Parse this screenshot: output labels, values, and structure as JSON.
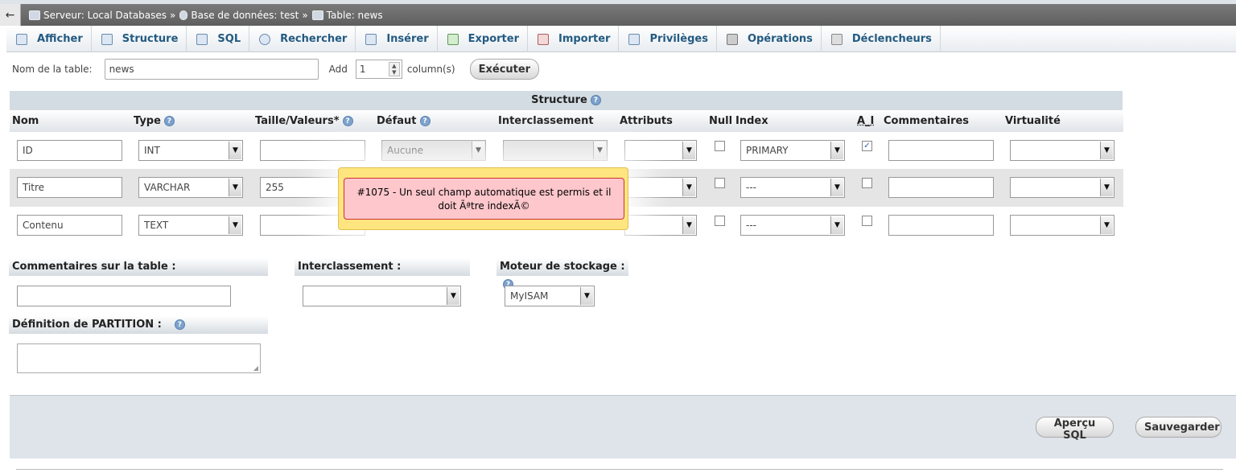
{
  "breadcrumb": {
    "back": "←",
    "server": "Serveur: Local Databases",
    "database": "Base de données: test",
    "table": "Table: news",
    "separator": "»"
  },
  "tabs": [
    {
      "label": "Afficher",
      "icon": "browse-icon"
    },
    {
      "label": "Structure",
      "icon": "structure-icon"
    },
    {
      "label": "SQL",
      "icon": "sql-icon"
    },
    {
      "label": "Rechercher",
      "icon": "search-icon"
    },
    {
      "label": "Insérer",
      "icon": "insert-icon"
    },
    {
      "label": "Exporter",
      "icon": "export-icon"
    },
    {
      "label": "Importer",
      "icon": "import-icon"
    },
    {
      "label": "Privilèges",
      "icon": "privileges-icon"
    },
    {
      "label": "Opérations",
      "icon": "wrench-icon"
    },
    {
      "label": "Déclencheurs",
      "icon": "triggers-icon"
    }
  ],
  "name_bar": {
    "table_name_label": "Nom de la table:",
    "table_name_value": "news",
    "add_label": "Add",
    "add_count": "1",
    "columns_label": "column(s)",
    "execute_label": "Exécuter"
  },
  "structure": {
    "title": "Structure",
    "headers": {
      "nom": "Nom",
      "type": "Type",
      "taille": "Taille/Valeurs*",
      "defaut": "Défaut",
      "interclassement": "Interclassement",
      "attributs": "Attributs",
      "null": "Null",
      "index": "Index",
      "ai": "A_I",
      "commentaires": "Commentaires",
      "virtualite": "Virtualité"
    },
    "rows": [
      {
        "name": "ID",
        "type": "INT",
        "length": "",
        "default": "Aucune",
        "index": "PRIMARY",
        "ai": "✓"
      },
      {
        "name": "Titre",
        "type": "VARCHAR",
        "length": "255",
        "default": "",
        "index": "---",
        "ai": ""
      },
      {
        "name": "Contenu",
        "type": "TEXT",
        "length": "",
        "default": "",
        "index": "---",
        "ai": ""
      }
    ]
  },
  "error": {
    "message": "#1075 - Un seul champ automatique est permis et il doit Ãªtre indexÃ©"
  },
  "options": {
    "comment_label": "Commentaires sur la table :",
    "collation_label": "Interclassement :",
    "engine_label": "Moteur de stockage :",
    "engine_value": "MyISAM",
    "partition_label": "Définition de PARTITION :"
  },
  "footer": {
    "preview_label": "Aperçu SQL",
    "save_label": "Sauvegarder"
  },
  "colors": {
    "tab_text": "#235a81",
    "error_bg": "#fdc7cc",
    "error_outer": "#ffe57f"
  }
}
